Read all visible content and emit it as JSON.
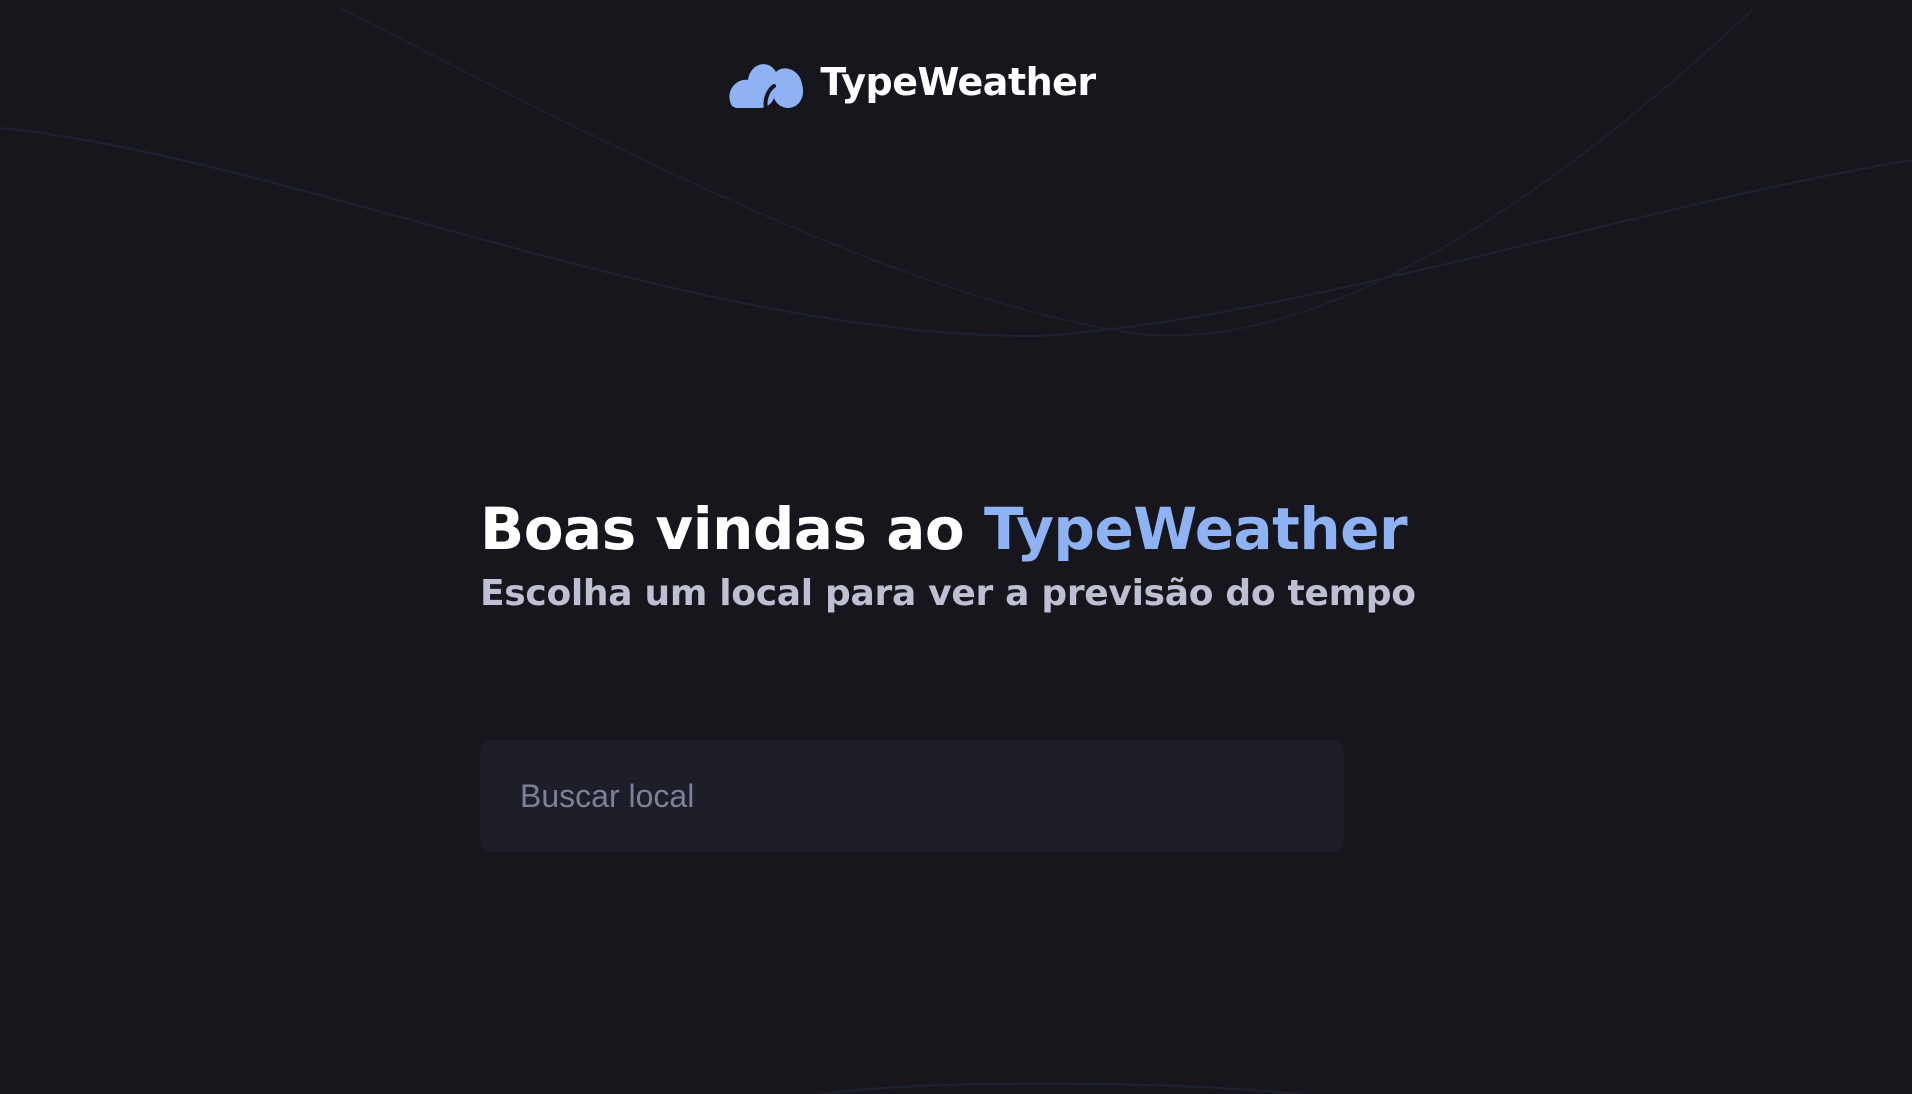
{
  "app": {
    "name": "TypeWeather"
  },
  "logo": {
    "icon": "cloud-icon",
    "text": "TypeWeather",
    "icon_color": "#8FB2F5"
  },
  "hero": {
    "title_prefix": "Boas vindas ao ",
    "title_highlight": "TypeWeather",
    "subtitle": "Escolha um local para ver a previsão do tempo"
  },
  "search": {
    "value": "",
    "placeholder": "Buscar local"
  },
  "colors": {
    "background": "#16161C",
    "accent": "#8FB2F5",
    "input_background": "#1E1E29",
    "subtitle": "#BFBFD4",
    "placeholder": "#7F7F98"
  }
}
